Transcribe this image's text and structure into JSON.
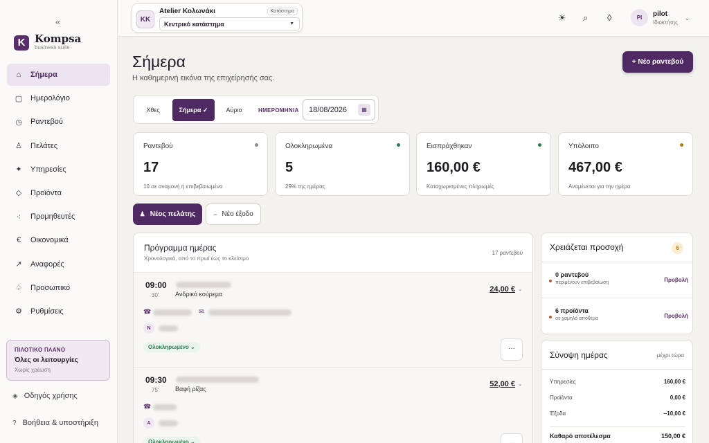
{
  "sidebar": {
    "collapse_icon": "«",
    "brand_name": "Kompsa",
    "brand_sub": "business suite",
    "logo_letter": "K",
    "items": [
      {
        "label": "Σήμερα",
        "icon": "home-icon",
        "glyph": "⌂"
      },
      {
        "label": "Ημερολόγιο",
        "icon": "calendar-icon",
        "glyph": "▢"
      },
      {
        "label": "Ραντεβού",
        "icon": "clock-icon",
        "glyph": "◷"
      },
      {
        "label": "Πελάτες",
        "icon": "person-icon",
        "glyph": "♙"
      },
      {
        "label": "Υπηρεσίες",
        "icon": "sparkle-icon",
        "glyph": "✦"
      },
      {
        "label": "Προϊόντα",
        "icon": "diamond-icon",
        "glyph": "◇"
      },
      {
        "label": "Προμηθευτές",
        "icon": "dots-icon",
        "glyph": "⁖"
      },
      {
        "label": "Οικονομικά",
        "icon": "euro-icon",
        "glyph": "€"
      },
      {
        "label": "Αναφορές",
        "icon": "trend-icon",
        "glyph": "↗"
      },
      {
        "label": "Προσωπικό",
        "icon": "staff-icon",
        "glyph": "♤"
      },
      {
        "label": "Ρυθμίσεις",
        "icon": "gear-icon",
        "glyph": "⚙"
      }
    ],
    "plan": {
      "tag": "ΠΙΛΟΤΙΚΟ ΠΛΑΝΟ",
      "title": "Όλες οι λειτουργίες",
      "sub": "Χωρίς χρέωση"
    },
    "guide": "Οδηγός χρήσης",
    "help": "Βοήθεια & υποστήριξη"
  },
  "topbar": {
    "store_initials": "KK",
    "store_name": "Atelier Κολωνάκι",
    "store_badge": "Κατάστημα",
    "store_select": "Κεντρικό κατάστημα",
    "user_initials": "PI",
    "user_name": "pilot",
    "user_role": "Ιδιοκτήτης"
  },
  "page": {
    "title": "Σήμερα",
    "subtitle": "Η καθημερινή εικόνα της επιχείρησής σας.",
    "new_button": "+ Νέο ραντεβού"
  },
  "datebar": {
    "prev": "Χθες",
    "today": "Σήμερα ✓",
    "next": "Αύριο",
    "date_label": "ΗΜΕΡΟΜΗΝΙΑ",
    "date_value": "18/08/2026"
  },
  "stats": [
    {
      "label": "Ραντεβού",
      "value": "17",
      "note": "10 σε αναμονή ή επιβεβαιωμένα",
      "color": "#8a8a8a"
    },
    {
      "label": "Ολοκληρωμένα",
      "value": "5",
      "note": "29% της ημέρας",
      "color": "#2e7d4f"
    },
    {
      "label": "Εισπράχθηκαν",
      "value": "160,00 €",
      "note": "Καταχωρισμένες πληρωμές",
      "color": "#2e7d4f"
    },
    {
      "label": "Υπόλοιπο",
      "value": "467,00 €",
      "note": "Αναμένεται για την ημέρα",
      "color": "#b07a1a"
    }
  ],
  "actions": {
    "new_client": "Νέος πελάτης",
    "new_expense": "Νέο έξοδο"
  },
  "schedule": {
    "title": "Πρόγραμμα ημέρας",
    "sub": "Χρονολογικά, από το πρωί έως το κλείσιμο",
    "count": "17 ραντεβού",
    "appointments": [
      {
        "time": "09:00",
        "duration": "30'",
        "service": "Ανδρικό κούρεμα",
        "price": "24,00 €",
        "initial": "N",
        "status": "Ολοκληρωμένο ⌄"
      },
      {
        "time": "09:30",
        "duration": "75'",
        "service": "Βαφή ρίζας",
        "price": "52,00 €",
        "initial": "A",
        "status": "Ολοκληρωμένο ⌄"
      }
    ],
    "more": "···"
  },
  "attention": {
    "title": "Χρειάζεται προσοχή",
    "count": "6",
    "rows": [
      {
        "title": "0 ραντεβού",
        "sub": "περιμένουν επιβεβαίωση",
        "link": "Προβολή"
      },
      {
        "title": "6 προϊόντα",
        "sub": "σε χαμηλό απόθεμα",
        "link": "Προβολή"
      }
    ]
  },
  "summary": {
    "title": "Σύνοψη ημέρας",
    "note": "μέχρι τώρα",
    "rows": [
      {
        "label": "Υπηρεσίες",
        "value": "160,00 €"
      },
      {
        "label": "Προϊόντα",
        "value": "0,00 €"
      },
      {
        "label": "Έξοδα",
        "value": "−10,00 €"
      }
    ],
    "total_label": "Καθαρό αποτέλεσμα",
    "total_value": "150,00 €"
  },
  "colors": {
    "accent": "#4f2a62",
    "accent_light": "#ece4f0",
    "success": "#2e7d4f",
    "background": "#f4f2ef"
  }
}
